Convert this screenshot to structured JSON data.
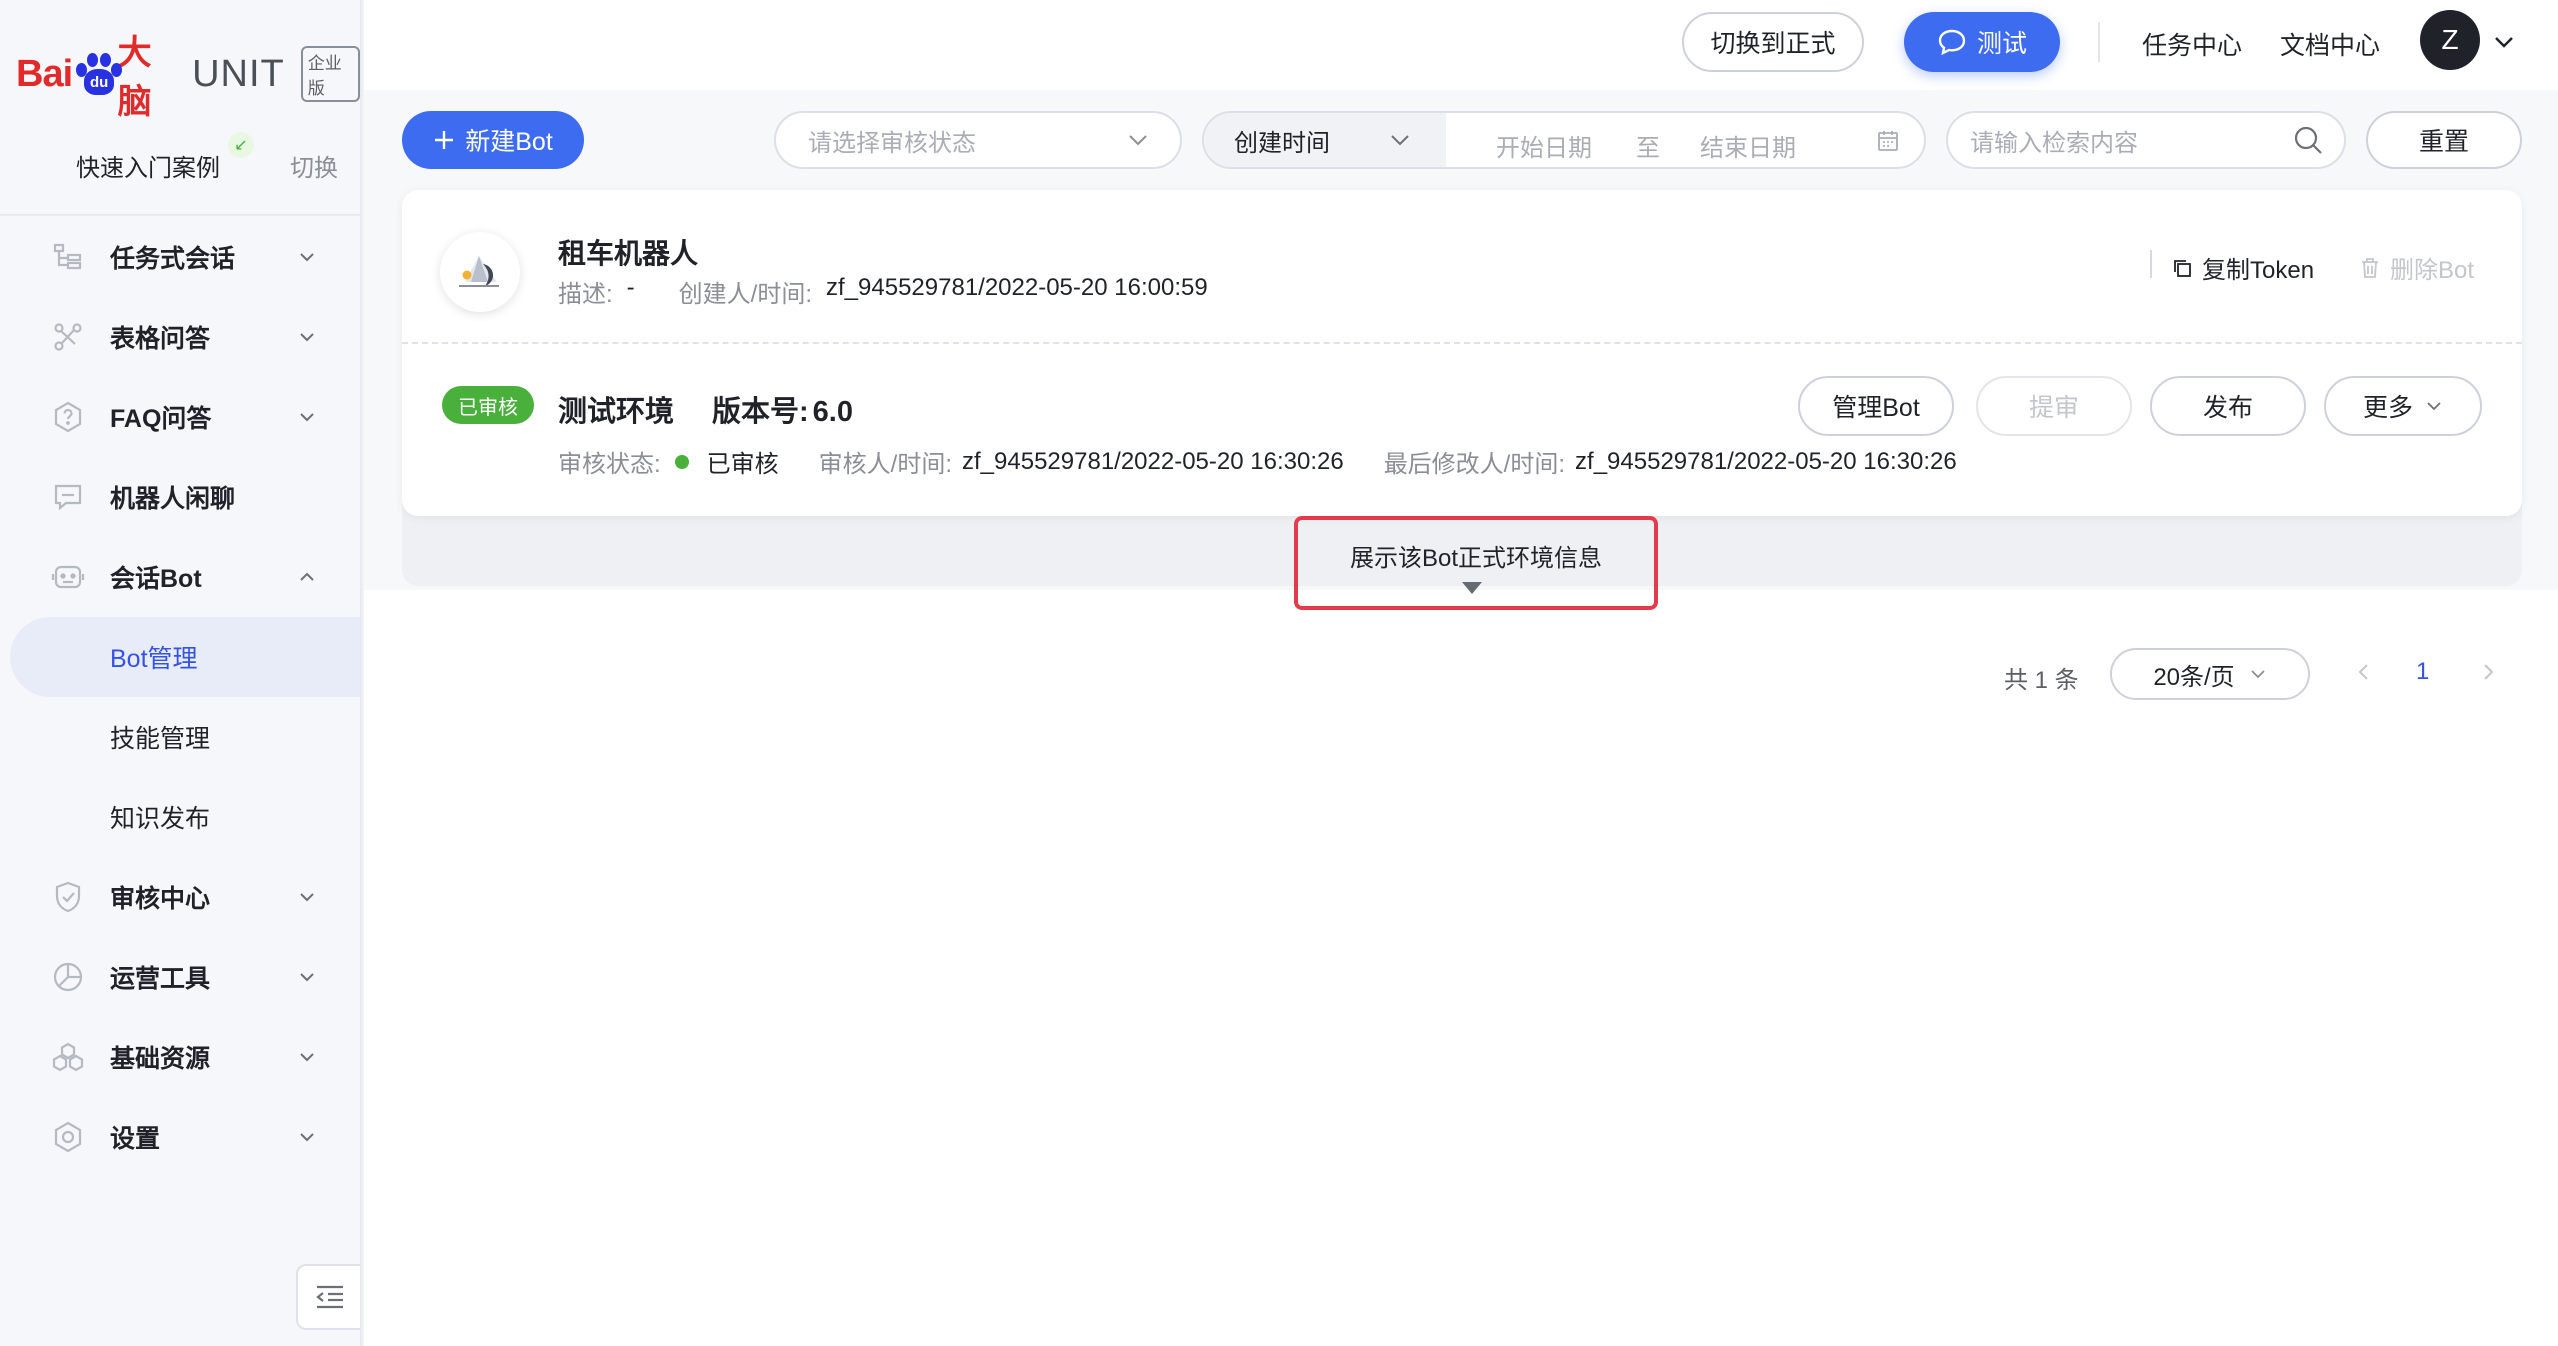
{
  "brand": {
    "logo_text": "Bai",
    "logo_paw_text": "du",
    "logo_cn": "大脑",
    "product": "UNIT",
    "edition": "企业版"
  },
  "sidebar": {
    "quick_start": "快速入门案例",
    "switch": "切换",
    "items": [
      {
        "label": "任务式会话",
        "icon": "task-dialog-icon",
        "expanded": false
      },
      {
        "label": "表格问答",
        "icon": "table-qa-icon",
        "expanded": false
      },
      {
        "label": "FAQ问答",
        "icon": "faq-icon",
        "expanded": false
      },
      {
        "label": "机器人闲聊",
        "icon": "chat-icon",
        "expanded": null
      },
      {
        "label": "会话Bot",
        "icon": "bot-icon",
        "expanded": true
      },
      {
        "label": "审核中心",
        "icon": "shield-icon",
        "expanded": false
      },
      {
        "label": "运营工具",
        "icon": "operation-icon",
        "expanded": false
      },
      {
        "label": "基础资源",
        "icon": "resource-icon",
        "expanded": false
      },
      {
        "label": "设置",
        "icon": "settings-icon",
        "expanded": false
      }
    ],
    "sub_items": [
      {
        "label": "Bot管理",
        "active": true
      },
      {
        "label": "技能管理",
        "active": false
      },
      {
        "label": "知识发布",
        "active": false
      }
    ]
  },
  "header": {
    "switch_env": "切换到正式",
    "test": "测试",
    "task_center": "任务中心",
    "doc_center": "文档中心",
    "avatar_letter": "Z"
  },
  "toolbar": {
    "new_bot": "新建Bot",
    "audit_status_placeholder": "请选择审核状态",
    "date_type": "创建时间",
    "start_date_placeholder": "开始日期",
    "date_separator": "至",
    "end_date_placeholder": "结束日期",
    "search_placeholder": "请输入检索内容",
    "reset": "重置"
  },
  "bot": {
    "name": "租车机器人",
    "desc_label": "描述:",
    "desc_value": "-",
    "creator_label": "创建人/时间:",
    "creator_value": "zf_945529781/2022-05-20 16:00:59",
    "copy_token": "复制Token",
    "delete_bot": "删除Bot",
    "env": {
      "status_tag": "已审核",
      "name": "测试环境",
      "version_label": "版本号:",
      "version_value": "6.0",
      "audit_status_label": "审核状态:",
      "audit_status_value": "已审核",
      "auditor_label": "审核人/时间:",
      "auditor_value": "zf_945529781/2022-05-20 16:30:26",
      "modifier_label": "最后修改人/时间:",
      "modifier_value": "zf_945529781/2022-05-20 16:30:26",
      "buttons": {
        "manage": "管理Bot",
        "submit_audit": "提审",
        "publish": "发布",
        "more": "更多"
      }
    },
    "expand_info": "展示该Bot正式环境信息"
  },
  "pagination": {
    "total": "共 1 条",
    "page_size": "20条/页",
    "current_page": "1"
  },
  "colors": {
    "primary": "#3d6cf0",
    "success": "#48b03b",
    "highlight_border": "#e53a4a",
    "brand_red": "#e12a2a",
    "brand_blue": "#2932e1"
  }
}
